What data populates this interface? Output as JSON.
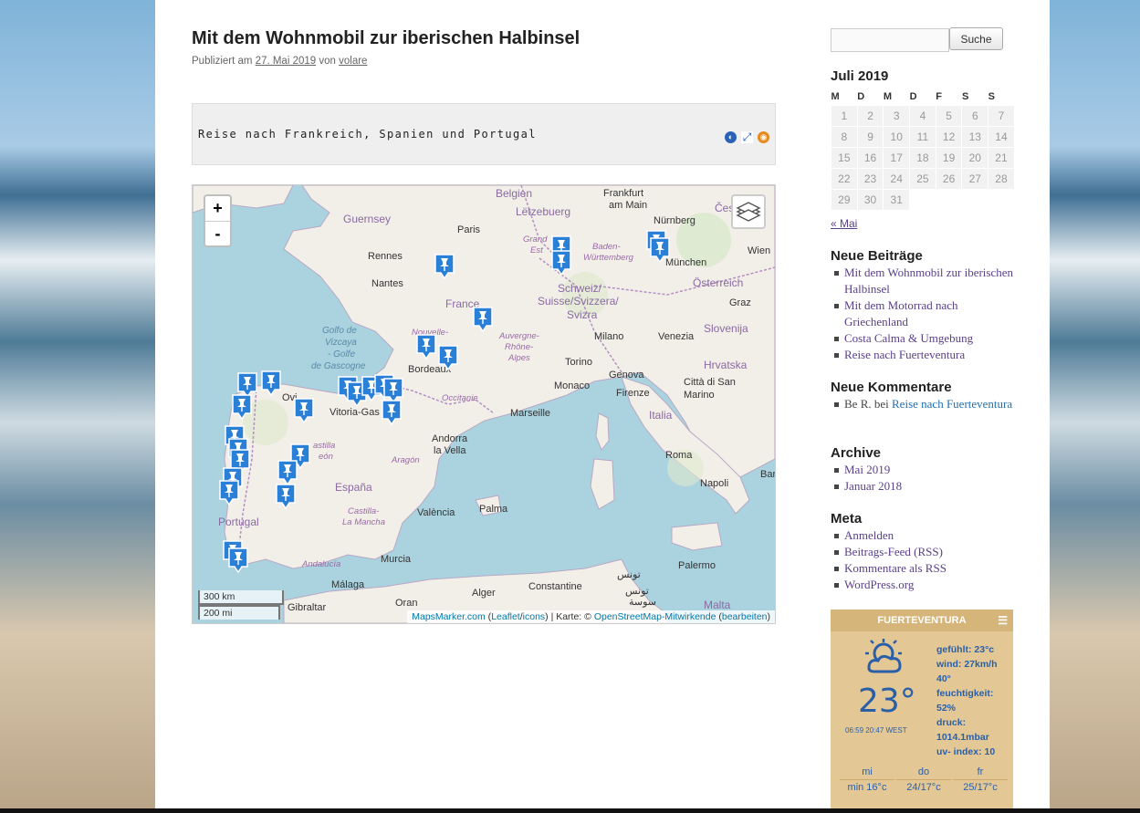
{
  "post": {
    "title": "Mit dem Wohnmobil zur iberischen Halbinsel",
    "meta_prefix": "Publiziert am",
    "date": "27. Mai 2019",
    "meta_by": "von",
    "author": "volare"
  },
  "map_header": {
    "title": "Reise nach Frankreich, Spanien und Portugal",
    "icons": [
      "kml-icon",
      "fullscreen-icon",
      "rss-icon"
    ]
  },
  "map": {
    "zoom_in": "+",
    "zoom_out": "-",
    "scale_km": "300 km",
    "scale_mi": "200 mi",
    "attribution": {
      "link1": "MapsMarker.com",
      "paren_open": " (",
      "link2": "Leaflet",
      "sep": "/",
      "link3": "icons",
      "mid": ") | Karte: © ",
      "link4": "OpenStreetMap-Mitwirkende",
      "paren2": " (",
      "link5": "bearbeiten",
      "end": ")"
    },
    "labels": {
      "belgien": "Belgien",
      "frankfurt": "Frankfurt",
      "am_main": "am Main",
      "guernsey": "Guernsey",
      "paris": "Paris",
      "letzeburg": "Lëtzebuerg",
      "nurnberg": "Nürnberg",
      "cesko": "Čes",
      "rennes": "Rennes",
      "grand_est": "Grand",
      "est": "Est",
      "baden": "Baden-",
      "wurtt": "Württemberg",
      "wien": "Wien",
      "munchen": "München",
      "nantes": "Nantes",
      "schweiz": "Schweiz/",
      "suisse": "Suisse/Svizzera/",
      "svizra": "Svizra",
      "osterreich": "Österreich",
      "graz": "Graz",
      "france": "France",
      "golfo1": "Golfo de",
      "golfo2": "Vizcaya",
      "golfo3": "- Golfe",
      "golfo4": "de Gascogne",
      "nouvelle": "Nouvelle-",
      "auvergne1": "Auvergne-",
      "auvergne2": "Rhône-",
      "auvergne3": "Alpes",
      "milano": "Milano",
      "venezia": "Venezia",
      "slovenija": "Slovenija",
      "bordeaux": "Bordeaux",
      "torino": "Torino",
      "hrvatska": "Hrvatska",
      "oviedo": "Ovi",
      "vitoria": "Vitoria-Gas",
      "monaco": "Monaco",
      "genova": "Genova",
      "citta": "Città di San",
      "marino": "Marino",
      "occitanie": "Occitanie",
      "firenze": "Firenze",
      "italia": "Italia",
      "marseille": "Marseille",
      "andorra1": "Andorra",
      "andorra2": "la Vella",
      "castilla1": "astilla",
      "leon": "eón",
      "aragon": "Aragón",
      "roma": "Roma",
      "espana": "España",
      "napoli": "Napoli",
      "bari": "Bar",
      "castilla_lm1": "Castilla-",
      "castilla_lm2": "La Mancha",
      "palma": "Palma",
      "valencia": "València",
      "portugal": "Portugal",
      "andalucia": "Andalucía",
      "murcia": "Murcia",
      "palermo": "Palermo",
      "tunis": "تونس",
      "malaga": "Málaga",
      "gibraltar": "Gibraltar",
      "oran": "Oran",
      "alger": "Alger",
      "constantine": "Constantine",
      "tunisia": "تونس",
      "sousse": "سوسة",
      "malta": "Malta"
    }
  },
  "sidebar": {
    "search_button": "Suche",
    "search_value": "",
    "calendar": {
      "caption": "Juli 2019",
      "weekdays": [
        "M",
        "D",
        "M",
        "D",
        "F",
        "S",
        "S"
      ],
      "weeks": [
        [
          "1",
          "2",
          "3",
          "4",
          "5",
          "6",
          "7"
        ],
        [
          "8",
          "9",
          "10",
          "11",
          "12",
          "13",
          "14"
        ],
        [
          "15",
          "16",
          "17",
          "18",
          "19",
          "20",
          "21"
        ],
        [
          "22",
          "23",
          "24",
          "25",
          "26",
          "27",
          "28"
        ],
        [
          "29",
          "30",
          "31",
          "",
          "",
          "",
          ""
        ]
      ],
      "prev": "« Mai"
    },
    "recent_posts": {
      "title": "Neue Beiträge",
      "items": [
        "Mit dem Wohnmobil zur iberischen Halbinsel",
        "Mit dem Motorrad nach Griechenland",
        "Costa Calma & Umgebung",
        "Reise nach Fuerteventura"
      ]
    },
    "recent_comments": {
      "title": "Neue Kommentare",
      "author": "Be R.",
      "on": "bei",
      "post": "Reise nach Fuerteventura"
    },
    "archive": {
      "title": "Archive",
      "items": [
        "Mai 2019",
        "Januar 2018"
      ]
    },
    "meta": {
      "title": "Meta",
      "items": [
        "Anmelden",
        "Beitrags-Feed (RSS)",
        "Kommentare als RSS",
        "WordPress.org"
      ]
    },
    "weather": {
      "title": "FUERTEVENTURA",
      "temp": "23°",
      "sun": "06:59 20:47 WEST",
      "felt": "gefühlt: 23°c",
      "wind": "wind: 27km/h",
      "wind_dir": "40°",
      "humidity_label": "feuchtigkeit:",
      "humidity": "52%",
      "pressure_label": "druck:",
      "pressure": "1014.1mbar",
      "uv": "uv- index: 10",
      "days": [
        {
          "name": "mi",
          "range": "min 16°c"
        },
        {
          "name": "do",
          "range": "24/17°c"
        },
        {
          "name": "fr",
          "range": "25/17°c"
        }
      ]
    }
  }
}
